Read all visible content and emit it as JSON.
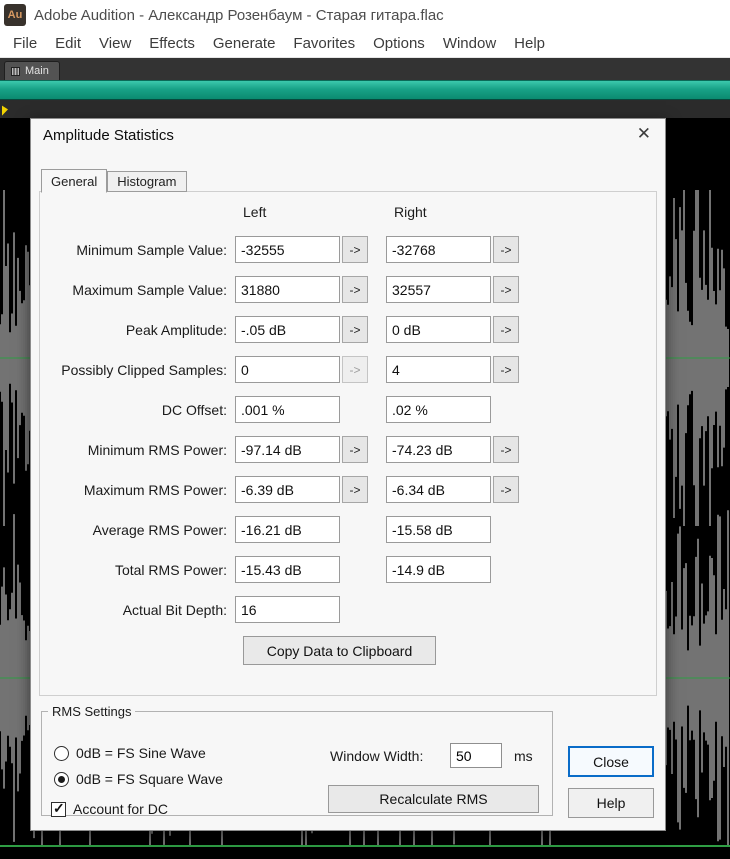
{
  "window": {
    "icon_text": "Au",
    "title": "Adobe Audition - Александр Розенбаум - Старая гитара.flac"
  },
  "menubar": {
    "items": [
      "File",
      "Edit",
      "View",
      "Effects",
      "Generate",
      "Favorites",
      "Options",
      "Window",
      "Help"
    ]
  },
  "workspace": {
    "main_tab": "Main"
  },
  "dialog": {
    "title": "Amplitude Statistics",
    "close_icon": "✕",
    "tabs": {
      "general": "General",
      "histogram": "Histogram"
    },
    "columns": {
      "left": "Left",
      "right": "Right"
    },
    "arrow_label": "->",
    "rows": [
      {
        "label": "Minimum Sample Value:",
        "left": "-32555",
        "right": "-32768",
        "left_arrow": "enabled",
        "right_arrow": "enabled"
      },
      {
        "label": "Maximum Sample Value:",
        "left": "31880",
        "right": "32557",
        "left_arrow": "enabled",
        "right_arrow": "enabled"
      },
      {
        "label": "Peak Amplitude:",
        "left": "-.05 dB",
        "right": "0 dB",
        "left_arrow": "enabled",
        "right_arrow": "enabled"
      },
      {
        "label": "Possibly Clipped Samples:",
        "left": "0",
        "right": "4",
        "left_arrow": "disabled",
        "right_arrow": "enabled"
      },
      {
        "label": "DC Offset:",
        "left": ".001 %",
        "right": ".02 %",
        "left_arrow": "none",
        "right_arrow": "none"
      },
      {
        "label": "Minimum RMS Power:",
        "left": "-97.14 dB",
        "right": "-74.23 dB",
        "left_arrow": "enabled",
        "right_arrow": "enabled"
      },
      {
        "label": "Maximum RMS Power:",
        "left": "-6.39 dB",
        "right": "-6.34 dB",
        "left_arrow": "enabled",
        "right_arrow": "enabled"
      },
      {
        "label": "Average RMS Power:",
        "left": "-16.21 dB",
        "right": "-15.58 dB",
        "left_arrow": "none",
        "right_arrow": "none"
      },
      {
        "label": "Total RMS Power:",
        "left": "-15.43 dB",
        "right": "-14.9 dB",
        "left_arrow": "none",
        "right_arrow": "none"
      },
      {
        "label": "Actual Bit Depth:",
        "left": "16",
        "right": null,
        "left_arrow": "none",
        "right_arrow": "none"
      }
    ],
    "copy_button": "Copy Data to Clipboard",
    "rms_settings": {
      "legend": "RMS Settings",
      "radio_sine": {
        "label": "0dB = FS Sine Wave",
        "selected": false
      },
      "radio_square": {
        "label": "0dB = FS Square Wave",
        "selected": true
      },
      "account_dc": {
        "label": "Account for DC",
        "checked": true
      },
      "window_width_label": "Window Width:",
      "window_width_value": "50",
      "window_width_unit": "ms",
      "recalculate_button": "Recalculate RMS"
    },
    "close_button": "Close",
    "help_button": "Help"
  },
  "colors": {
    "accent_teal": "#18a287",
    "default_button_border": "#0a6cc8",
    "waveform": "#e6e6e6",
    "wave_center_line": "#2f9e44",
    "marker_yellow": "#f2d300"
  }
}
